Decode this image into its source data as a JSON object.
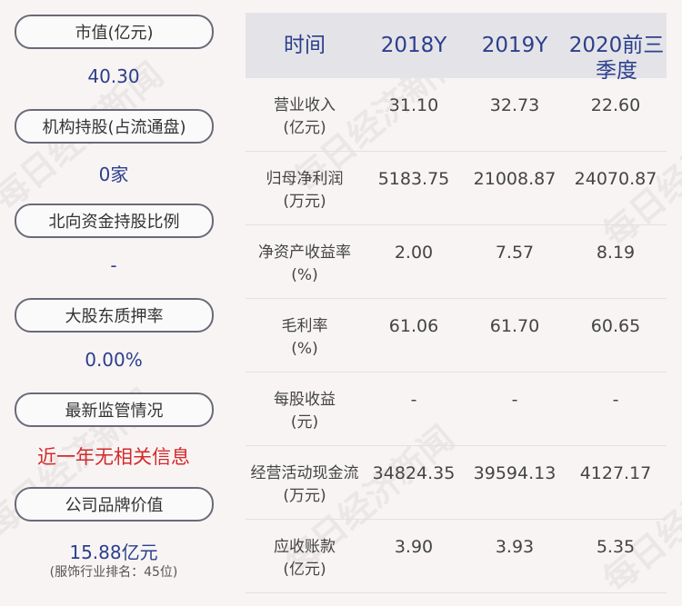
{
  "left": {
    "items": [
      {
        "label": "市值(亿元)",
        "value": "40.30"
      },
      {
        "label": "机构持股(占流通盘)",
        "value": "0家"
      },
      {
        "label": "北向资金持股比例",
        "value": "-"
      },
      {
        "label": "大股东质押率",
        "value": "0.00%"
      },
      {
        "label": "最新监管情况",
        "value": "近一年无相关信息"
      },
      {
        "label": "公司品牌价值",
        "value": "15.88亿元",
        "note": "(服饰行业排名：45位)"
      }
    ]
  },
  "table": {
    "headers": [
      "时间",
      "2018Y",
      "2019Y",
      "2020前三季度"
    ],
    "rows": [
      {
        "label": "营业收入",
        "unit": "(亿元)",
        "values": [
          "31.10",
          "32.73",
          "22.60"
        ]
      },
      {
        "label": "归母净利润",
        "unit": "(万元)",
        "values": [
          "5183.75",
          "21008.87",
          "24070.87"
        ]
      },
      {
        "label": "净资产收益率",
        "unit": "(%)",
        "values": [
          "2.00",
          "7.57",
          "8.19"
        ]
      },
      {
        "label": "毛利率",
        "unit": "(%)",
        "values": [
          "61.06",
          "61.70",
          "60.65"
        ]
      },
      {
        "label": "每股收益",
        "unit": "(元)",
        "values": [
          "-",
          "-",
          "-"
        ]
      },
      {
        "label": "经营活动现金流",
        "unit": "(万元)",
        "values": [
          "34824.35",
          "39594.13",
          "4127.17"
        ]
      },
      {
        "label": "应收账款",
        "unit": "(亿元)",
        "values": [
          "3.90",
          "3.93",
          "5.35"
        ]
      }
    ]
  },
  "watermark": "每日经济新闻"
}
